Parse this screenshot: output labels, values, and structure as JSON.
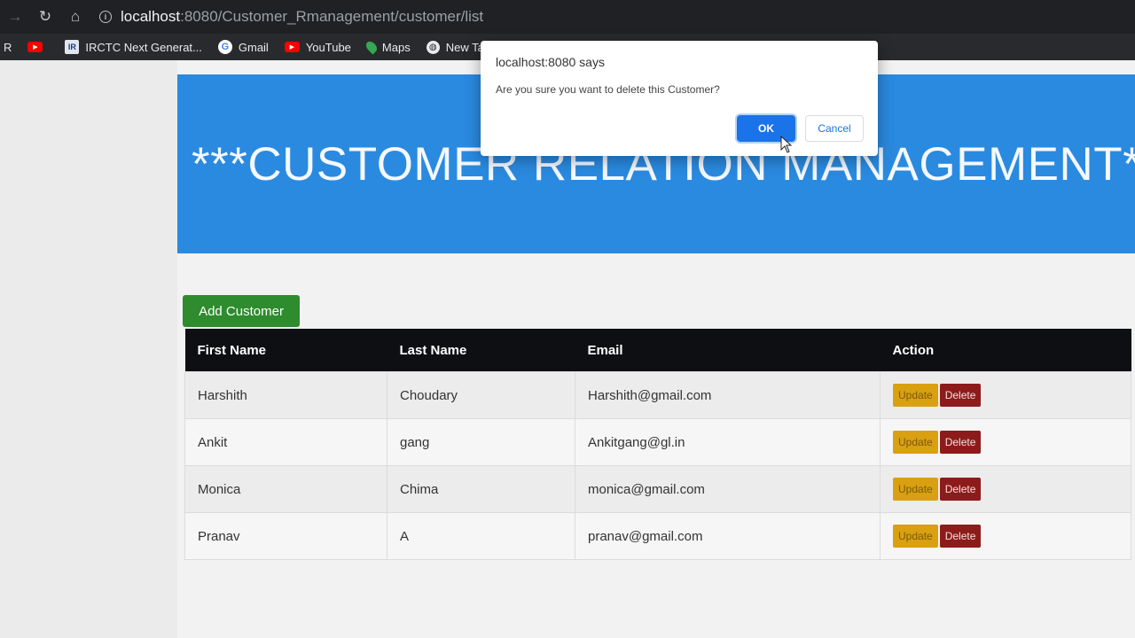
{
  "browser": {
    "url_host": "localhost",
    "url_path": ":8080/Customer_Rmanagement/customer/list",
    "bookmarks": [
      {
        "label": "R",
        "icon": "profile-icon"
      },
      {
        "label": "",
        "icon": "youtube-icon"
      },
      {
        "label": "IRCTC Next Generat...",
        "icon": "irctc-icon"
      },
      {
        "label": "Gmail",
        "icon": "google-icon"
      },
      {
        "label": "YouTube",
        "icon": "youtube-icon"
      },
      {
        "label": "Maps",
        "icon": "maps-icon"
      },
      {
        "label": "New Tab",
        "icon": "globe-icon"
      }
    ]
  },
  "page": {
    "banner_title": "***CUSTOMER RELATION MANAGEMENT***",
    "add_button": "Add Customer",
    "table": {
      "headers": [
        "First Name",
        "Last Name",
        "Email",
        "Action"
      ],
      "rows": [
        {
          "first": "Harshith",
          "last": "Choudary",
          "email": "Harshith@gmail.com"
        },
        {
          "first": "Ankit",
          "last": "gang",
          "email": "Ankitgang@gl.in"
        },
        {
          "first": "Monica",
          "last": "Chima",
          "email": "monica@gmail.com"
        },
        {
          "first": "Pranav",
          "last": "A",
          "email": "pranav@gmail.com"
        }
      ],
      "update_label": "Update",
      "delete_label": "Delete"
    }
  },
  "dialog": {
    "title": "localhost:8080 says",
    "message": "Are you sure you want to delete this Customer?",
    "ok": "OK",
    "cancel": "Cancel"
  },
  "colors": {
    "banner": "#2a8ae0",
    "add_button": "#2e8b2e",
    "update_button": "#d9a012",
    "delete_button": "#8e1b1b",
    "table_header": "#0d0f12",
    "dialog_ok": "#1a73e8"
  }
}
